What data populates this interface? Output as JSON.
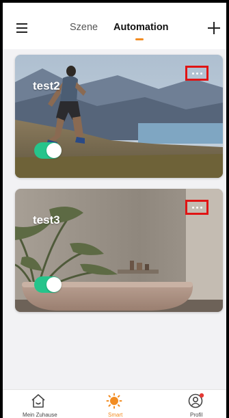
{
  "header": {
    "tabs": [
      {
        "label": "Szene",
        "active": false
      },
      {
        "label": "Automation",
        "active": true
      }
    ],
    "accent_color": "#f28c22"
  },
  "automations": [
    {
      "name": "test2",
      "enabled": true,
      "image": "runner-lake-landscape"
    },
    {
      "name": "test3",
      "enabled": true,
      "image": "bathroom-palm-bathtub"
    }
  ],
  "bottom_nav": {
    "items": [
      {
        "label": "Mein Zuhause",
        "icon": "home-icon",
        "active": false
      },
      {
        "label": "Smart",
        "icon": "sun-icon",
        "active": true
      },
      {
        "label": "Profil",
        "icon": "profile-icon",
        "active": false
      }
    ]
  },
  "colors": {
    "toggle_on": "#26c48b",
    "highlight_box": "#e01414",
    "notification_dot": "#e53935"
  }
}
